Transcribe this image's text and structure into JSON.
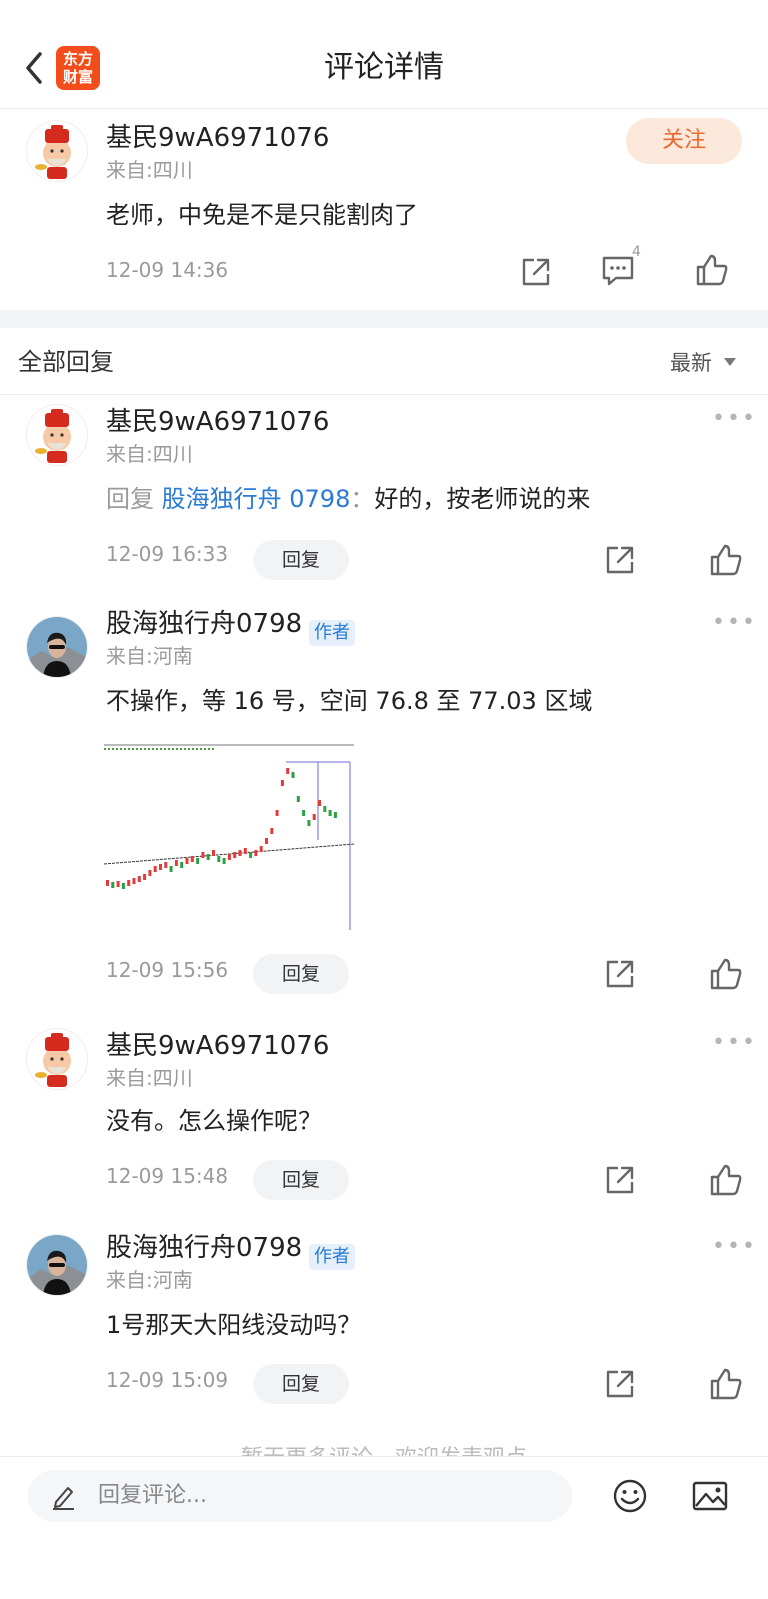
{
  "header": {
    "title": "评论详情",
    "logo_line1": "东方",
    "logo_line2": "财富"
  },
  "main_comment": {
    "username": "基民9wA6971076",
    "location": "来自:四川",
    "text": "老师，中免是不是只能割肉了",
    "time": "12-09 14:36",
    "follow_label": "关注",
    "reply_count": "4"
  },
  "replies_header": {
    "label": "全部回复",
    "sort": "最新"
  },
  "replies": [
    {
      "username": "基民9wA6971076",
      "location": "来自:四川",
      "reply_prefix": "回复",
      "reply_to": "股海独行舟 0798",
      "reply_colon": "：",
      "text": "好的，按老师说的来",
      "time": "12-09 16:33",
      "reply_label": "回复"
    },
    {
      "username": "股海独行舟0798",
      "author_tag": "作者",
      "location": "来自:河南",
      "text": "不操作，等 16 号，空间 76.8 至 77.03 区域",
      "time": "12-09 15:56",
      "reply_label": "回复",
      "has_image": true
    },
    {
      "username": "基民9wA6971076",
      "location": "来自:四川",
      "text": "没有。怎么操作呢？",
      "time": "12-09 15:48",
      "reply_label": "回复"
    },
    {
      "username": "股海独行舟0798",
      "author_tag": "作者",
      "location": "来自:河南",
      "text": "1号那天大阳线没动吗？",
      "time": "12-09 15:09",
      "reply_label": "回复"
    }
  ],
  "end_text": "暂无更多评论，欢迎发表观点",
  "footer": {
    "placeholder": "回复评论..."
  },
  "colors": {
    "accent": "#f24d1b",
    "link": "#2a7ad6",
    "follow_bg": "#fde8dc",
    "follow_text": "#ec6b2e"
  }
}
